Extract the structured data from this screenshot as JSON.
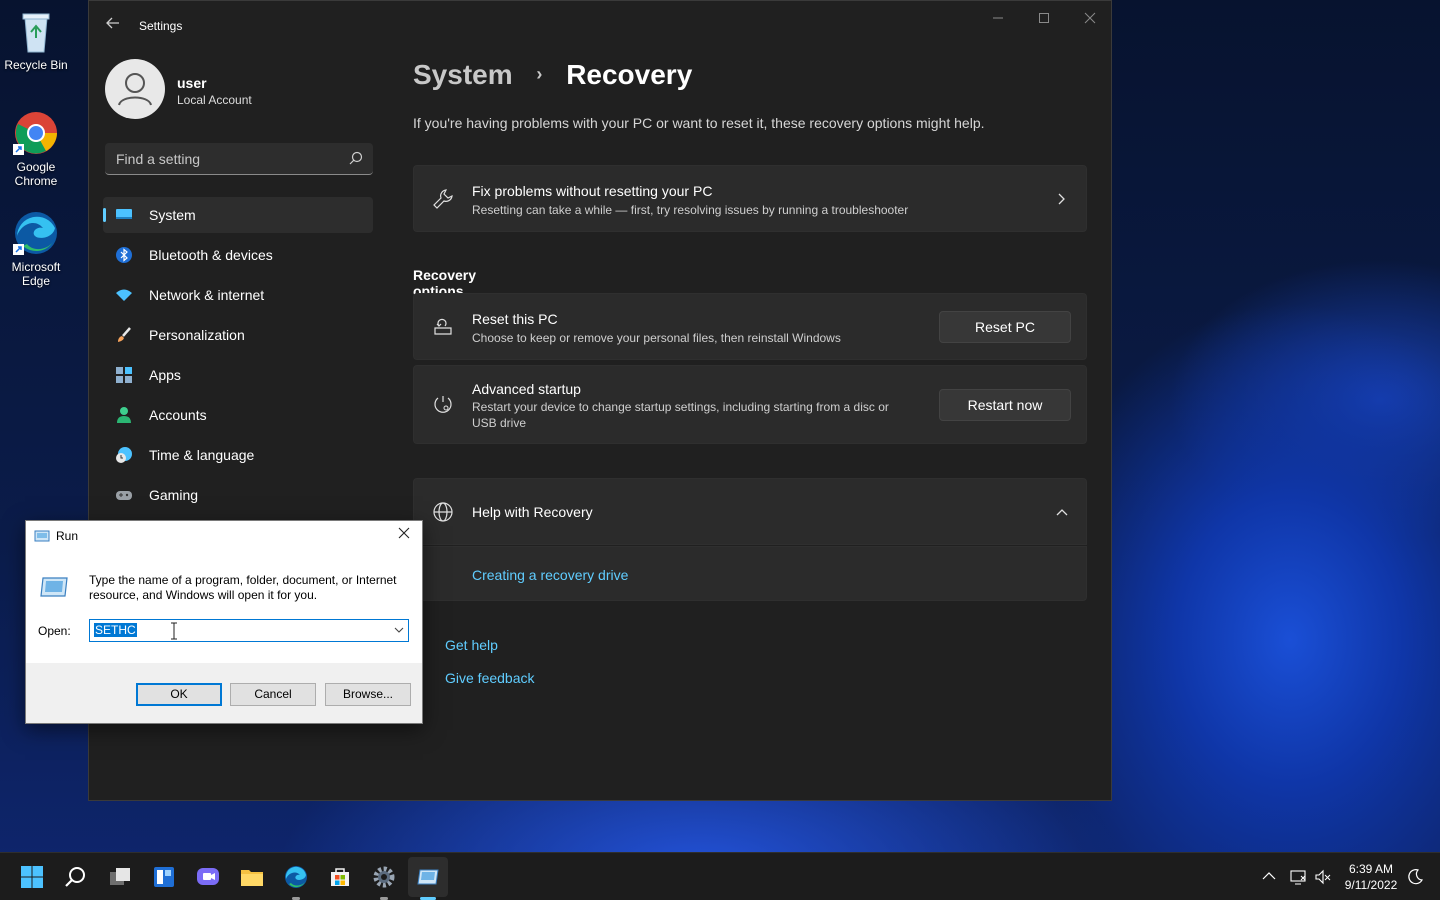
{
  "desktop": {
    "icons": [
      {
        "label": "Recycle Bin"
      },
      {
        "label": "Google\nChrome"
      },
      {
        "label": "Microsoft\nEdge"
      }
    ]
  },
  "settings": {
    "window_title": "Settings",
    "profile": {
      "name": "user",
      "account_type": "Local Account"
    },
    "search_placeholder": "Find a setting",
    "nav": [
      {
        "label": "System",
        "icon": "system-icon",
        "active": true
      },
      {
        "label": "Bluetooth & devices",
        "icon": "bluetooth-icon"
      },
      {
        "label": "Network & internet",
        "icon": "wifi-icon"
      },
      {
        "label": "Personalization",
        "icon": "brush-icon"
      },
      {
        "label": "Apps",
        "icon": "apps-icon"
      },
      {
        "label": "Accounts",
        "icon": "accounts-icon"
      },
      {
        "label": "Time & language",
        "icon": "clock-globe-icon"
      },
      {
        "label": "Gaming",
        "icon": "gamepad-icon"
      }
    ],
    "breadcrumb": {
      "parent": "System",
      "separator": "›",
      "current": "Recovery"
    },
    "description": "If you're having problems with your PC or want to reset it, these recovery options might help.",
    "fix_card": {
      "title": "Fix problems without resetting your PC",
      "subtitle": "Resetting can take a while — first, try resolving issues by running a troubleshooter"
    },
    "recovery_options_heading": "Recovery options",
    "reset_card": {
      "title": "Reset this PC",
      "subtitle": "Choose to keep or remove your personal files, then reinstall Windows",
      "button": "Reset PC"
    },
    "advanced_card": {
      "title": "Advanced startup",
      "subtitle": "Restart your device to change startup settings, including starting from a disc or USB drive",
      "button": "Restart now"
    },
    "help_card": {
      "title": "Help with Recovery",
      "link": "Creating a recovery drive"
    },
    "footer_links": {
      "get_help": "Get help",
      "give_feedback": "Give feedback"
    }
  },
  "run_dialog": {
    "title": "Run",
    "description": "Type the name of a program, folder, document, or Internet resource, and Windows will open it for you.",
    "open_label": "Open:",
    "open_value": "SETHC",
    "ok": "OK",
    "cancel": "Cancel",
    "browse": "Browse..."
  },
  "taskbar": {
    "time": "6:39 AM",
    "date": "9/11/2022"
  },
  "colors": {
    "accent": "#60cdff",
    "window_bg": "#202020",
    "card_bg": "#2b2b2b",
    "taskbar_bg": "#1c1c1c"
  }
}
